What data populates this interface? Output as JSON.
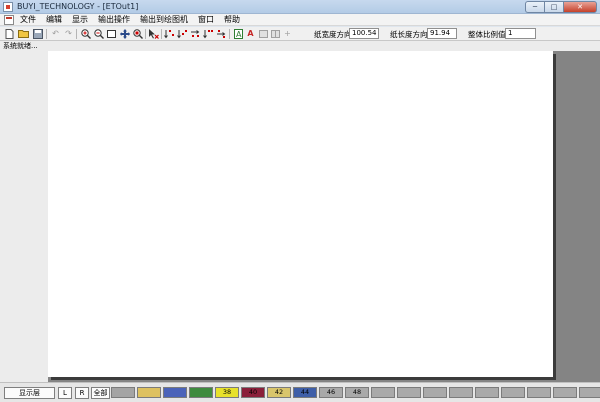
{
  "window": {
    "title": "BUYI_TECHNOLOGY - [ETOut1]",
    "minimize_glyph": "─",
    "maximize_glyph": "□",
    "close_glyph": "✕"
  },
  "menu": {
    "items": [
      "文件",
      "编辑",
      "显示",
      "输出操作",
      "输出到绘图机",
      "窗口",
      "帮助"
    ]
  },
  "toolbar": {
    "icons": [
      "new-file-icon",
      "open-folder-icon",
      "save-icon",
      "undo-icon",
      "redo-icon",
      "zoom-in-icon",
      "zoom-out-icon",
      "zoom-page-icon",
      "pan-icon",
      "zoom-window-icon",
      "select-delete-icon",
      "sort-icon-1",
      "sort-icon-2",
      "sort-icon-3",
      "sort-icon-4",
      "sort-icon-5",
      "outline-a-icon",
      "red-a-icon",
      "align-icon-1",
      "align-icon-2",
      "align-icon-3"
    ],
    "paper_width_label": "纸宽度方向",
    "paper_width_value": "100.54",
    "paper_length_label": "纸长度方向",
    "paper_length_value": "91.94",
    "scale_label": "整体比例值",
    "scale_value": "1"
  },
  "status": {
    "text": "系统就绪..."
  },
  "bottom": {
    "layer_label": "显示层",
    "l_label": "L",
    "r_label": "R",
    "all_label": "全部",
    "swatches": [
      {
        "label": "",
        "color": "#a4a4a4"
      },
      {
        "label": "",
        "color": "#ddc160"
      },
      {
        "label": "",
        "color": "#4b63b9"
      },
      {
        "label": "",
        "color": "#3e8b3e"
      },
      {
        "label": "38",
        "color": "#e7e12b"
      },
      {
        "label": "40",
        "color": "#8a1f3a"
      },
      {
        "label": "42",
        "color": "#d9c56b"
      },
      {
        "label": "44",
        "color": "#3f5fa8"
      },
      {
        "label": "46",
        "color": "#a9a9a9"
      },
      {
        "label": "48",
        "color": "#a9a9a9"
      },
      {
        "label": "",
        "color": "#a9a9a9"
      },
      {
        "label": "",
        "color": "#a9a9a9"
      },
      {
        "label": "",
        "color": "#a9a9a9"
      },
      {
        "label": "",
        "color": "#a9a9a9"
      },
      {
        "label": "",
        "color": "#a9a9a9"
      },
      {
        "label": "",
        "color": "#a9a9a9"
      },
      {
        "label": "",
        "color": "#a9a9a9"
      },
      {
        "label": "",
        "color": "#a9a9a9"
      },
      {
        "label": "",
        "color": "#a9a9a9"
      }
    ]
  }
}
